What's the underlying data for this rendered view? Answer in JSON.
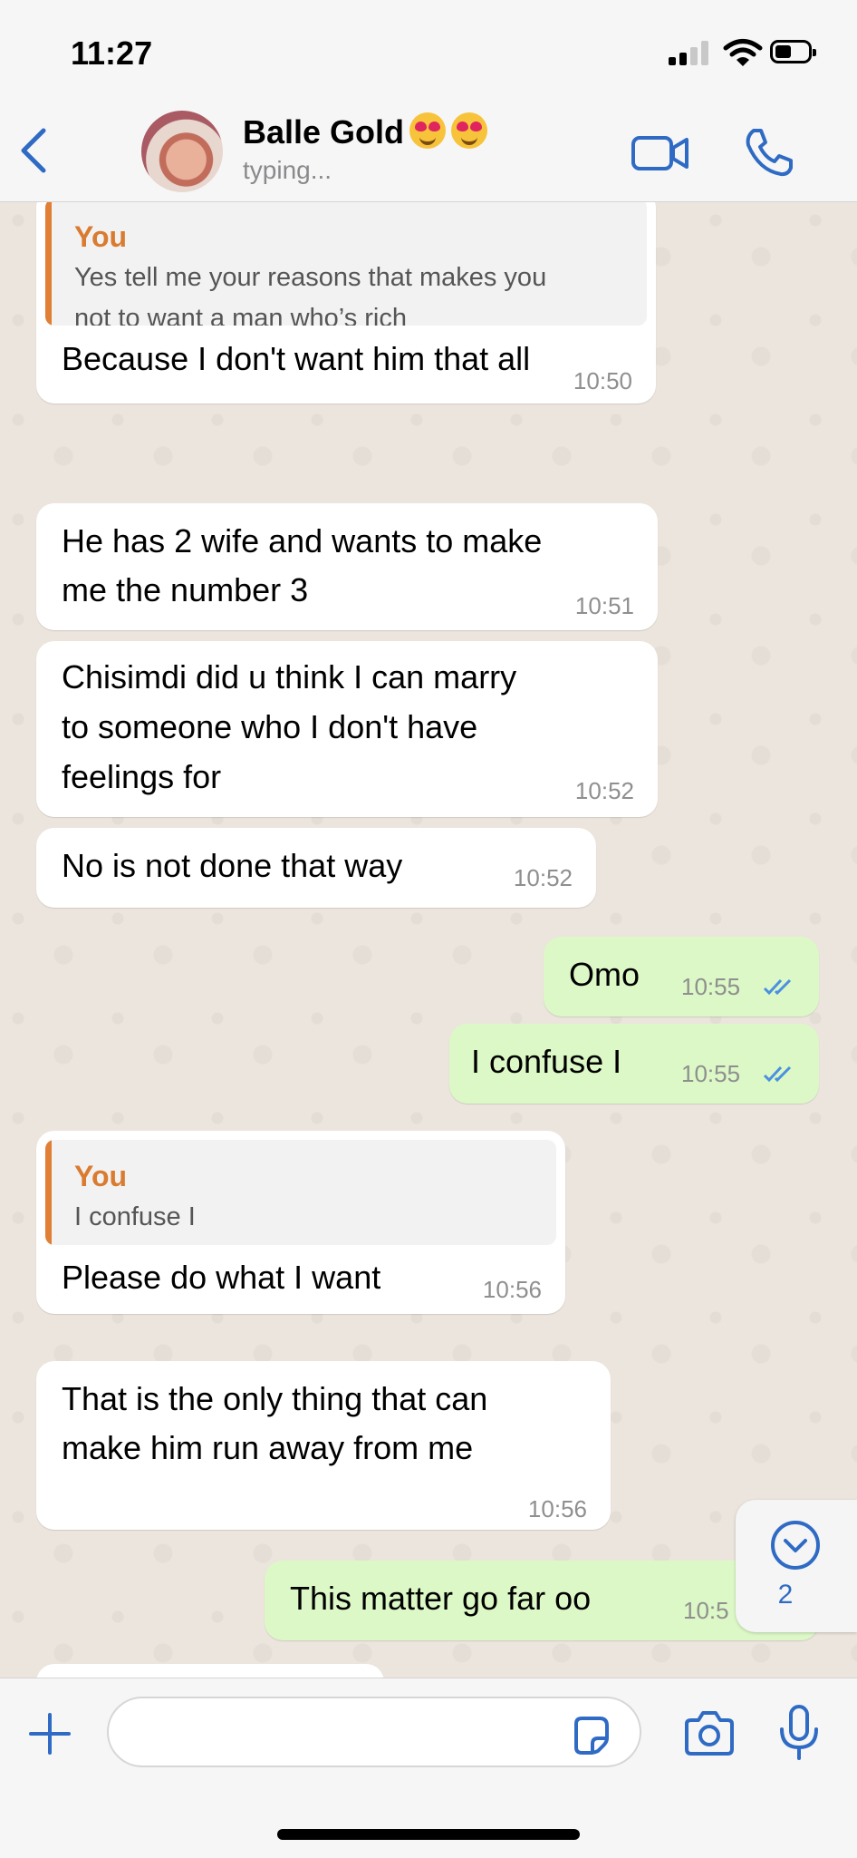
{
  "status_bar": {
    "time": "11:27"
  },
  "header": {
    "contact_name": "Balle Gold",
    "name_emojis": [
      "heart-eyes-emoji",
      "heart-eyes-emoji"
    ],
    "contact_status": "typing..."
  },
  "messages": [
    {
      "direction": "in",
      "reply": {
        "author": "You",
        "lines": [
          "Yes tell me your reasons that makes you",
          "not to want a man who’s rich"
        ]
      },
      "lines": [
        "Because I don't want him that all"
      ],
      "time": "10:50"
    },
    {
      "direction": "in",
      "lines": [
        "He has 2 wife and wants to make",
        "me the number 3"
      ],
      "time": "10:51"
    },
    {
      "direction": "in",
      "lines": [
        "Chisimdi did u think I can marry",
        "to someone who I don't have",
        "feelings for"
      ],
      "time": "10:52"
    },
    {
      "direction": "in",
      "lines": [
        "No is not done that way"
      ],
      "time": "10:52"
    },
    {
      "direction": "out",
      "lines": [
        "Omo"
      ],
      "time": "10:55"
    },
    {
      "direction": "out",
      "lines": [
        "I confuse I"
      ],
      "time": "10:55"
    },
    {
      "direction": "in",
      "reply": {
        "author": "You",
        "lines": [
          "I confuse I"
        ]
      },
      "lines": [
        "Please do what I want"
      ],
      "time": "10:56"
    },
    {
      "direction": "in",
      "lines": [
        "That is the only thing that can",
        "make him run away from me"
      ],
      "time": "10:56"
    },
    {
      "direction": "out",
      "lines": [
        "This matter go far oo"
      ],
      "time": "10:5"
    }
  ],
  "scroll_down": {
    "unread_count": "2"
  },
  "colors": {
    "accent": "#2f6bc4",
    "outgoing_bubble": "#dcf8c6",
    "incoming_bubble": "#ffffff",
    "reply_author": "#d97b30",
    "chat_bg": "#ece5dd"
  }
}
